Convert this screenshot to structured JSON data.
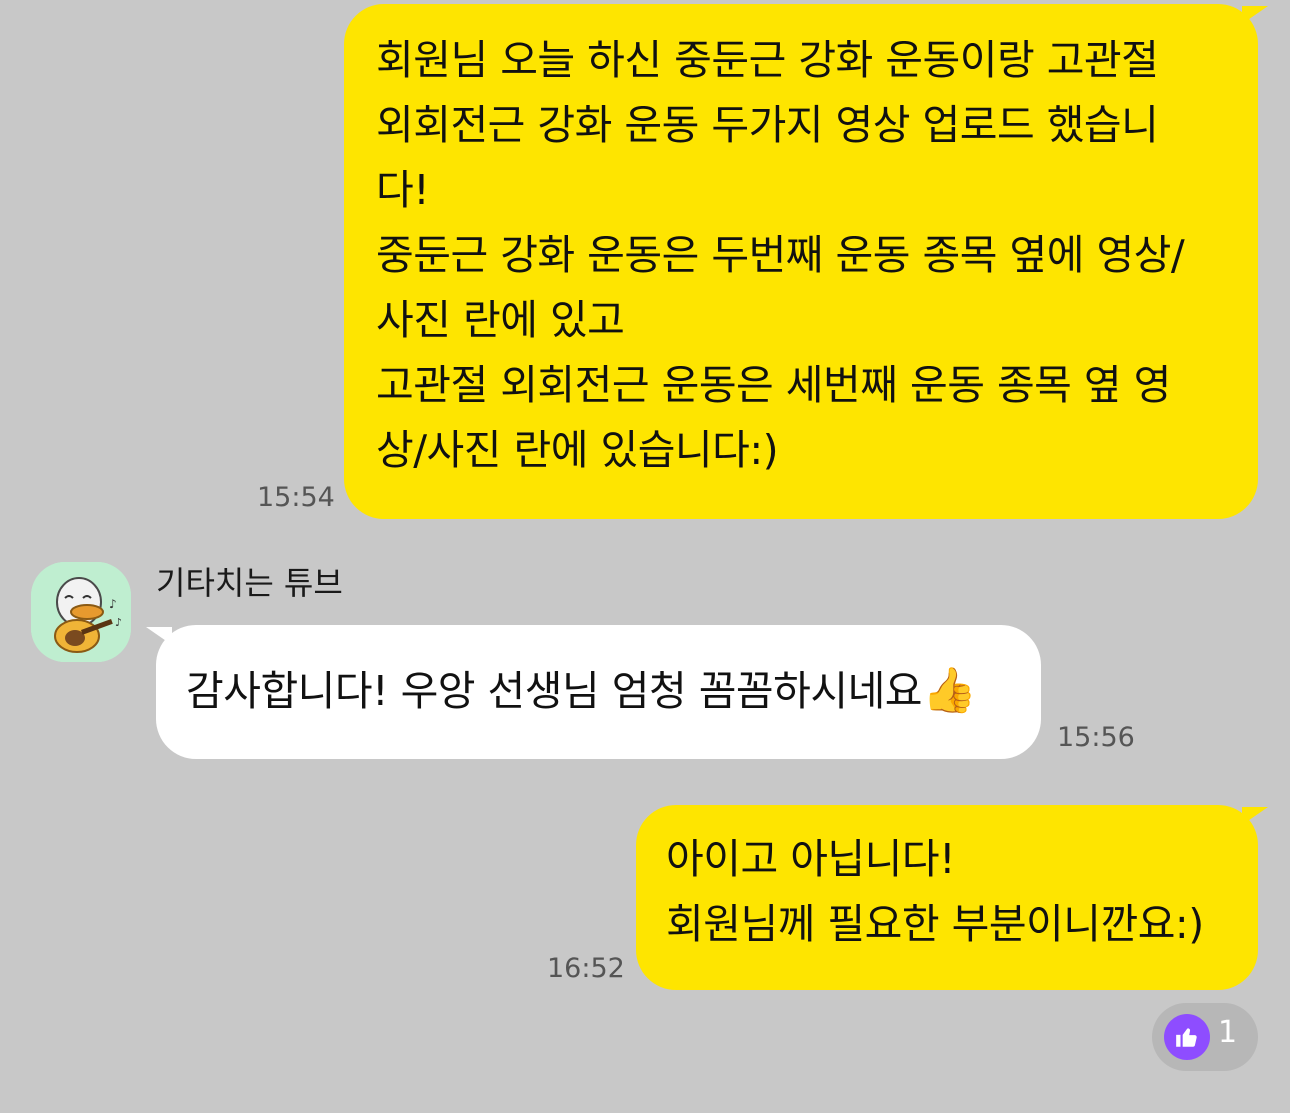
{
  "chat": {
    "messages": [
      {
        "sender": "me",
        "lines": [
          "회원님 오늘 하신 중둔근 강화 운동이랑 고관절",
          "외회전근 강화 운동 두가지 영상 업로드 했습니",
          "다!",
          "중둔근 강화 운동은 두번째 운동 종목 옆에 영상/",
          "사진 란에 있고",
          "고관절 외회전근 운동은 세번째 운동 종목 옆 영",
          "상/사진 란에 있습니다:)"
        ],
        "time": "15:54"
      },
      {
        "sender_name": "기타치는 튜브",
        "avatar_icon": "tube-duck-guitar-avatar-icon",
        "text": "감사합니다! 우앙 선생님 엄청 꼼꼼하시네요",
        "emoji": "👍",
        "time": "15:56"
      },
      {
        "sender": "me",
        "lines": [
          "아이고 아닙니다!",
          "회원님께 필요한 부분이니깐요:)"
        ],
        "time": "16:52",
        "reaction": {
          "icon": "thumbs-up-icon",
          "count": "1"
        }
      }
    ]
  },
  "colors": {
    "background": "#c8c8c8",
    "my_bubble": "#fee500",
    "other_bubble": "#ffffff",
    "reaction_accent": "#8e4dff"
  }
}
